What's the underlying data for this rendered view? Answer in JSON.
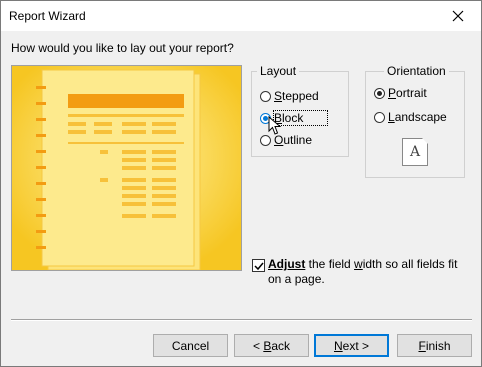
{
  "window": {
    "title": "Report Wizard"
  },
  "prompt": "How would you like to lay out your report?",
  "layout_group": {
    "label": "Layout",
    "options": [
      {
        "key": "S",
        "rest": "tepped",
        "checked": false
      },
      {
        "key": "B",
        "rest": "lock",
        "checked": true
      },
      {
        "key": "O",
        "rest": "utline",
        "checked": false
      }
    ]
  },
  "orientation_group": {
    "label": "Orientation",
    "options": [
      {
        "key": "P",
        "rest": "ortrait",
        "checked": true
      },
      {
        "key": "L",
        "rest": "andscape",
        "checked": false
      }
    ],
    "icon_letter": "A"
  },
  "adjust_checkbox": {
    "checked": true,
    "part1_underlined": "Adjust",
    "part2": " the field ",
    "part3_underlined": "w",
    "part4": "idth so all fields fit on a page."
  },
  "buttons": {
    "cancel": "Cancel",
    "back_prefix": "< ",
    "back_key": "B",
    "back_rest": "ack",
    "next_key": "N",
    "next_rest": "ext >",
    "finish_key": "F",
    "finish_rest": "inish"
  },
  "colors": {
    "preview_bg": "#fbd12f",
    "preview_accent": "#f39c12",
    "focus_blue": "#0078d7"
  }
}
